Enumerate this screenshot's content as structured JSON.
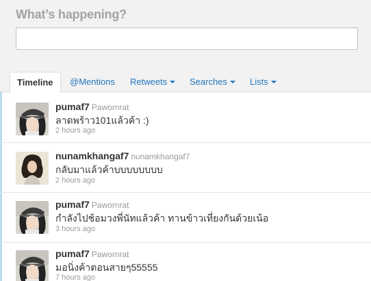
{
  "composer": {
    "title": "What’s happening?",
    "input_value": ""
  },
  "tabs": [
    {
      "label": "Timeline",
      "active": true,
      "has_dropdown": false
    },
    {
      "label": "@Mentions",
      "active": false,
      "has_dropdown": false
    },
    {
      "label": "Retweets",
      "active": false,
      "has_dropdown": true
    },
    {
      "label": "Searches",
      "active": false,
      "has_dropdown": true
    },
    {
      "label": "Lists",
      "active": false,
      "has_dropdown": true
    }
  ],
  "tweets": [
    {
      "screen_name": "pumaf7",
      "full_name": "Pawornrat",
      "text": "ลาดพร้าว101แล้วค้า :)",
      "time": "2 hours ago",
      "avatar": "avatar-photo-cap"
    },
    {
      "screen_name": "nunamkhangaf7",
      "full_name": "nunamkhangaf7",
      "text": "กลับมาแล้วค้าบบบบบบบบ",
      "time": "2 hours ago",
      "avatar": "avatar-photo-portrait"
    },
    {
      "screen_name": "pumaf7",
      "full_name": "Pawornrat",
      "text": "กำลังไปช้อมวงพี่นัทแล้วค้า ทานข้าวเที่ยงกันด้วยเน้อ",
      "time": "3 hours ago",
      "avatar": "avatar-photo-cap"
    },
    {
      "screen_name": "pumaf7",
      "full_name": "Pawornrat",
      "text": "มอนิ่งค้าตอนสายๆ55555",
      "time": "7 hours ago",
      "avatar": "avatar-photo-cap"
    }
  ],
  "colors": {
    "link": "#2276bb",
    "muted": "#999999",
    "header_bg": "#f2f2f2"
  }
}
